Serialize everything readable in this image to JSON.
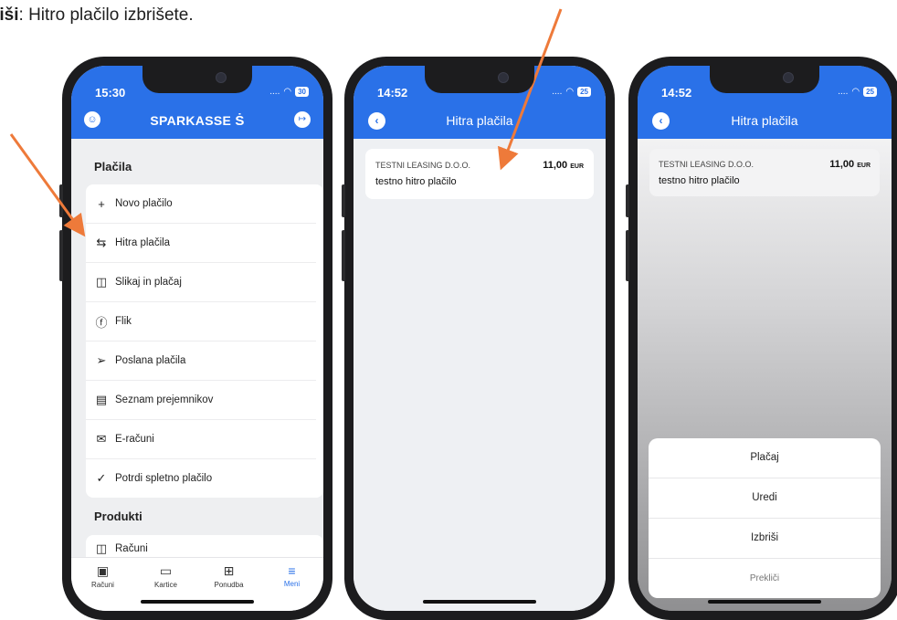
{
  "instruction": {
    "bold": "riši",
    "rest": ": Hitro plačilo izbrišete."
  },
  "colors": {
    "accent": "#2a71e8",
    "arrow": "#ee7a3a"
  },
  "phone1": {
    "time": "15:30",
    "battery": "30",
    "logo": "SPARKASSE",
    "logo_icon": "sparkasse-s-icon",
    "section_payments": "Plačila",
    "menu": [
      {
        "label": "Novo plačilo",
        "icon": "+"
      },
      {
        "label": "Hitra plačila",
        "icon": "⇆"
      },
      {
        "label": "Slikaj in plačaj",
        "icon": "◫"
      },
      {
        "label": "Flik",
        "icon": "ⓕ"
      },
      {
        "label": "Poslana plačila",
        "icon": "➢"
      },
      {
        "label": "Seznam prejemnikov",
        "icon": "▤"
      },
      {
        "label": "E-računi",
        "icon": "✉"
      },
      {
        "label": "Potrdi spletno plačilo",
        "icon": "✓"
      }
    ],
    "section_products": "Produkti",
    "product_first": "Računi",
    "tabs": [
      {
        "label": "Računi",
        "icon": "▣"
      },
      {
        "label": "Kartice",
        "icon": "▭"
      },
      {
        "label": "Ponudba",
        "icon": "⊞"
      },
      {
        "label": "Meni",
        "icon": "≡"
      }
    ]
  },
  "phone2": {
    "time": "14:52",
    "battery": "25",
    "title": "Hitra plačila",
    "item": {
      "name": "TESTNI LEASING D.O.O.",
      "desc": "testno hitro plačilo",
      "amount": "11,00",
      "currency": "EUR"
    }
  },
  "phone3": {
    "time": "14:52",
    "battery": "25",
    "title": "Hitra plačila",
    "item": {
      "name": "TESTNI LEASING D.O.O.",
      "desc": "testno hitro plačilo",
      "amount": "11,00",
      "currency": "EUR"
    },
    "actions": [
      "Plačaj",
      "Uredi",
      "Izbriši",
      "Prekliči"
    ]
  }
}
